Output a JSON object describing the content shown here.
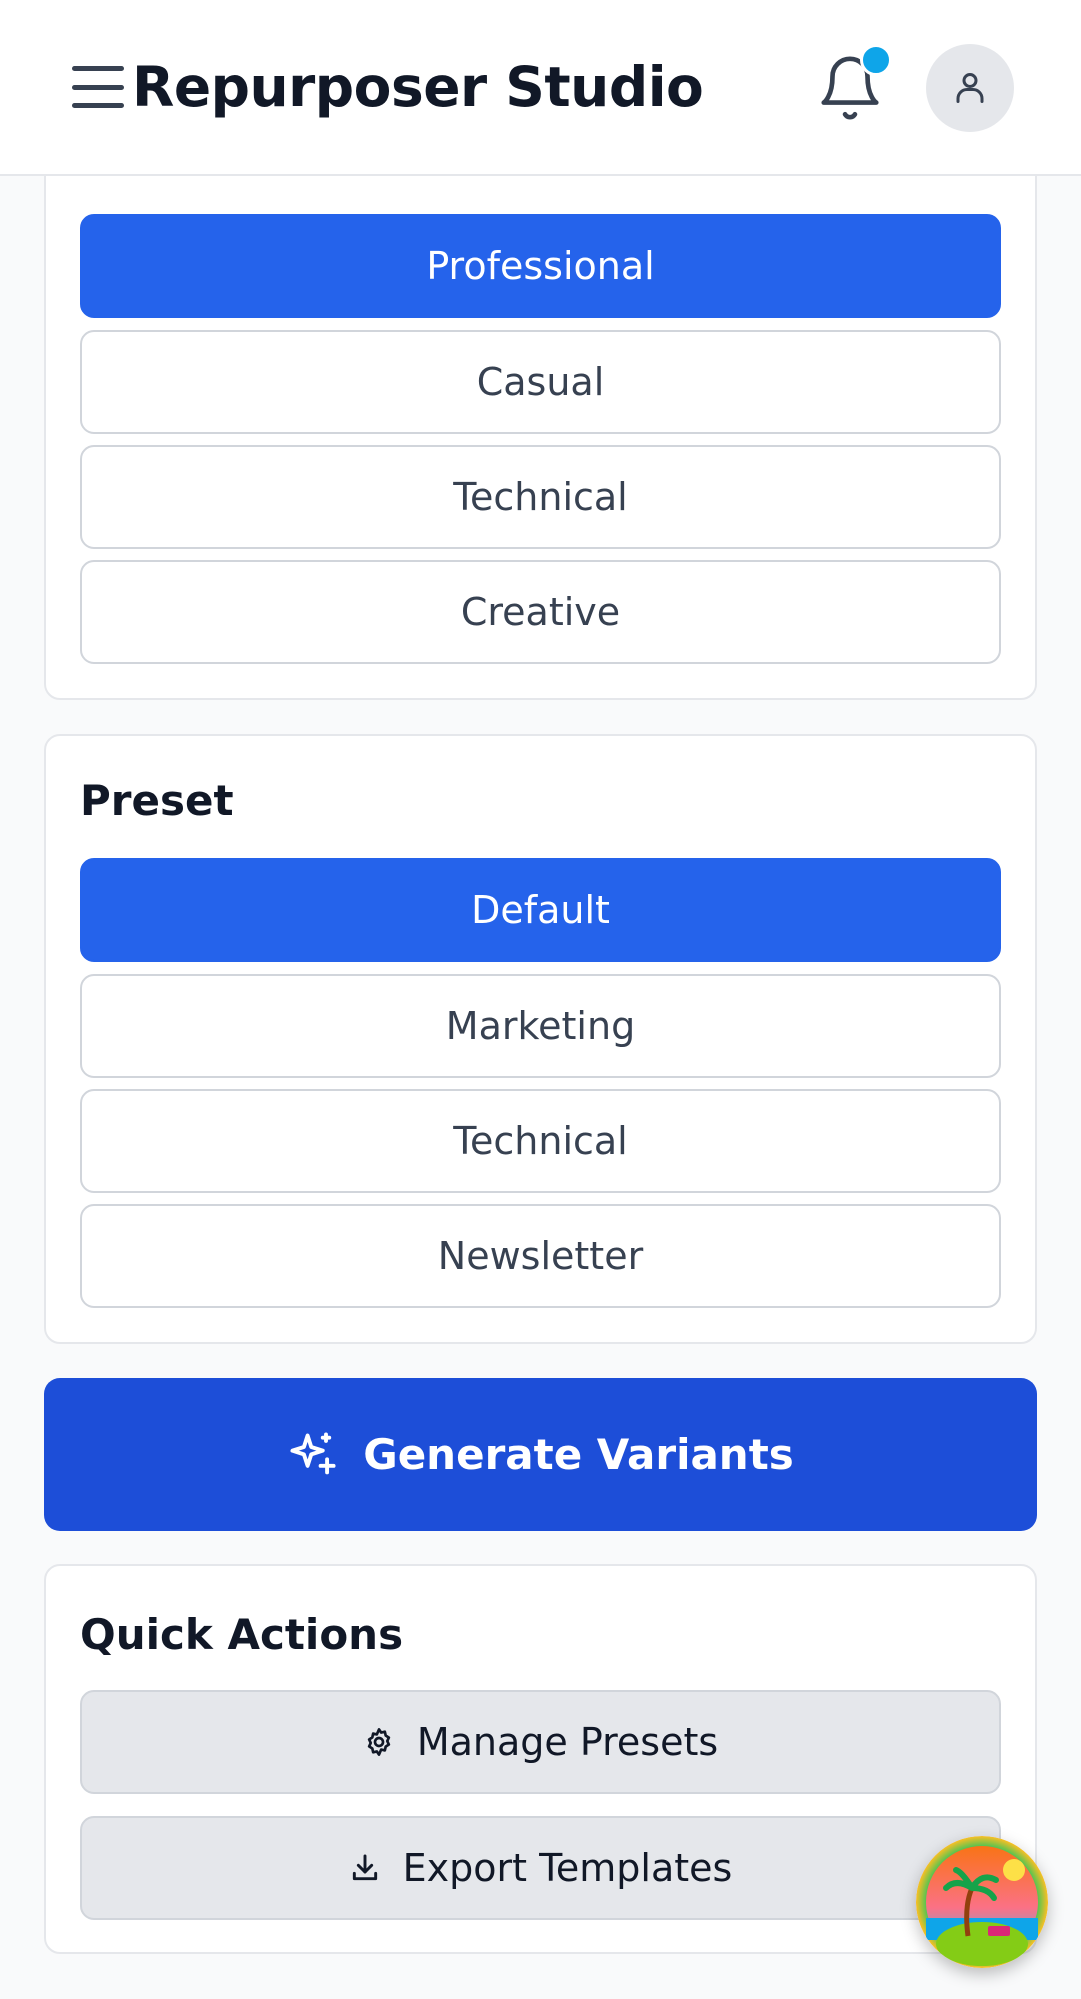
{
  "header": {
    "title": "Repurposer Studio"
  },
  "style_section": {
    "options": [
      {
        "label": "Professional",
        "selected": true
      },
      {
        "label": "Casual",
        "selected": false
      },
      {
        "label": "Technical",
        "selected": false
      },
      {
        "label": "Creative",
        "selected": false
      }
    ]
  },
  "preset_section": {
    "title": "Preset",
    "options": [
      {
        "label": "Default",
        "selected": true
      },
      {
        "label": "Marketing",
        "selected": false
      },
      {
        "label": "Technical",
        "selected": false
      },
      {
        "label": "Newsletter",
        "selected": false
      }
    ]
  },
  "generate": {
    "label": "Generate Variants",
    "icon": "sparkles-icon"
  },
  "quick_actions": {
    "title": "Quick Actions",
    "manage_presets": {
      "label": "Manage Presets",
      "icon": "gear-icon"
    },
    "export_templates": {
      "label": "Export Templates",
      "icon": "download-icon"
    }
  },
  "colors": {
    "primary": "#2563eb",
    "primary_dark": "#1d4ed8",
    "notification_dot": "#0ea5e9",
    "text_dark": "#111827",
    "border": "#d1d5db"
  }
}
